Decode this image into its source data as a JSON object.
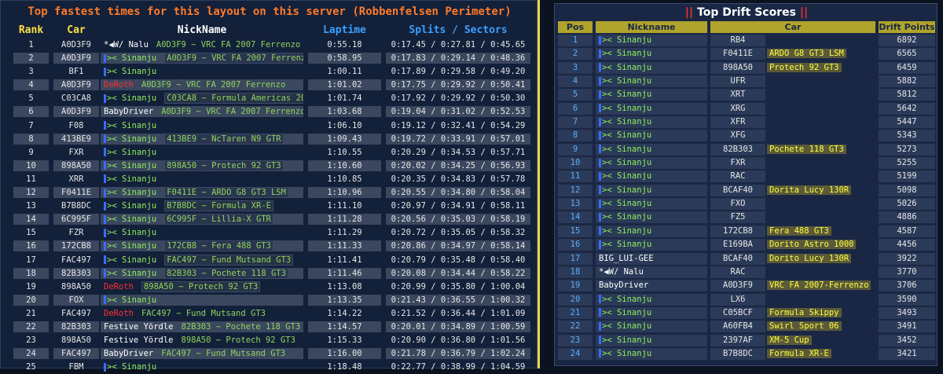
{
  "left": {
    "title": "Top fastest times for this layout on this server (Robbenfelsen Perimeter)",
    "headers": {
      "rank": "Rank",
      "car": "Car",
      "nick": "NickName",
      "laptime": "Laptime",
      "splits": "Splits / Sectors"
    },
    "rows": [
      {
        "rank": "1",
        "car": "A0D3F9",
        "nick": "*◀W/ Nalu",
        "carname": "A0D3F9 ~ VRC FA 2007 Ferrenzo",
        "lap": "0:55.18",
        "splits": "0:17.45 / 0:27.81 / 0:45.65",
        "type": "nalu",
        "box": false
      },
      {
        "rank": "2",
        "car": "A0D3F9",
        "nick": ">< Sinanju",
        "carname": "A0D3F9 ~ VRC FA 2007 Ferrenzo",
        "lap": "0:58.95",
        "splits": "0:17.83 / 0:29.14 / 0:48.36",
        "type": "sin",
        "box": true
      },
      {
        "rank": "3",
        "car": "BF1",
        "nick": ">< Sinanju",
        "carname": "",
        "lap": "1:00.11",
        "splits": "0:17.89 / 0:29.58 / 0:49.20",
        "type": "sin",
        "box": false
      },
      {
        "rank": "4",
        "car": "A0D3F9",
        "nick": "DeRoth",
        "carname": "A0D3F9 ~ VRC FA 2007 Ferrenzo",
        "lap": "1:01.02",
        "splits": "0:17.75 / 0:29.92 / 0:50.41",
        "type": "deroth",
        "box": false
      },
      {
        "rank": "5",
        "car": "C03CA8",
        "nick": ">< Sinanju",
        "carname": "C03CA8 ~ Formula Americas 2019",
        "lap": "1:01.74",
        "splits": "0:17.92 / 0:29.92 / 0:50.30",
        "type": "sin",
        "box": true
      },
      {
        "rank": "6",
        "car": "A0D3F9",
        "nick": "BabyDriver",
        "carname": "A0D3F9 ~ VRC FA 2007 Ferrenzo",
        "lap": "1:03.68",
        "splits": "0:19.04 / 0:31.02 / 0:52.53",
        "type": "baby",
        "box": false
      },
      {
        "rank": "7",
        "car": "F08",
        "nick": ">< Sinanju",
        "carname": "",
        "lap": "1:06.10",
        "splits": "0:19.12 / 0:32.41 / 0:54.29",
        "type": "sin",
        "box": false
      },
      {
        "rank": "8",
        "car": "413BE9",
        "nick": ">< Sinanju",
        "carname": "413BE9 ~ NcTaren N9 GTR",
        "lap": "1:09.43",
        "splits": "0:19.72 / 0:33.91 / 0:57.01",
        "type": "sin",
        "box": true
      },
      {
        "rank": "9",
        "car": "FXR",
        "nick": ">< Sinanju",
        "carname": "",
        "lap": "1:10.55",
        "splits": "0:20.29 / 0:34.53 / 0:57.71",
        "type": "sin",
        "box": false
      },
      {
        "rank": "10",
        "car": "898A50",
        "nick": ">< Sinanju",
        "carname": "898A50 ~ Protech 92 GT3",
        "lap": "1:10.60",
        "splits": "0:20.02 / 0:34.25 / 0:56.93",
        "type": "sin",
        "box": true
      },
      {
        "rank": "11",
        "car": "XRR",
        "nick": ">< Sinanju",
        "carname": "",
        "lap": "1:10.85",
        "splits": "0:20.35 / 0:34.83 / 0:57.78",
        "type": "sin",
        "box": false
      },
      {
        "rank": "12",
        "car": "F0411E",
        "nick": ">< Sinanju",
        "carname": "F0411E ~ ARDO G8 GT3 LSM",
        "lap": "1:10.96",
        "splits": "0:20.55 / 0:34.80 / 0:58.04",
        "type": "sin",
        "box": true
      },
      {
        "rank": "13",
        "car": "B7B8DC",
        "nick": ">< Sinanju",
        "carname": "B7B8DC ~ Formula XR-E",
        "lap": "1:11.10",
        "splits": "0:20.97 / 0:34.91 / 0:58.11",
        "type": "sin",
        "box": true
      },
      {
        "rank": "14",
        "car": "6C995F",
        "nick": ">< Sinanju",
        "carname": "6C995F ~ Lillia-X GTR",
        "lap": "1:11.28",
        "splits": "0:20.56 / 0:35.03 / 0:58.19",
        "type": "sin",
        "box": true
      },
      {
        "rank": "15",
        "car": "FZR",
        "nick": ">< Sinanju",
        "carname": "",
        "lap": "1:11.29",
        "splits": "0:20.72 / 0:35.05 / 0:58.32",
        "type": "sin",
        "box": false
      },
      {
        "rank": "16",
        "car": "172CB8",
        "nick": ">< Sinanju",
        "carname": "172CB8 ~ Fera 488 GT3",
        "lap": "1:11.33",
        "splits": "0:20.86 / 0:34.97 / 0:58.14",
        "type": "sin",
        "box": true
      },
      {
        "rank": "17",
        "car": "FAC497",
        "nick": ">< Sinanju",
        "carname": "FAC497 ~ Fund Mutsand GT3",
        "lap": "1:11.41",
        "splits": "0:20.79 / 0:35.48 / 0:58.40",
        "type": "sin",
        "box": true
      },
      {
        "rank": "18",
        "car": "82B303",
        "nick": ">< Sinanju",
        "carname": "82B303 ~ Pochete 118 GT3",
        "lap": "1:11.46",
        "splits": "0:20.08 / 0:34.44 / 0:58.22",
        "type": "sin",
        "box": true
      },
      {
        "rank": "19",
        "car": "898A50",
        "nick": "DeRoth",
        "carname": "898A50 ~ Protech 92 GT3",
        "lap": "1:13.08",
        "splits": "0:20.99 / 0:35.80 / 1:00.04",
        "type": "deroth",
        "box": true
      },
      {
        "rank": "20",
        "car": "FOX",
        "nick": ">< Sinanju",
        "carname": "",
        "lap": "1:13.35",
        "splits": "0:21.43 / 0:36.55 / 1:00.32",
        "type": "sin",
        "box": false
      },
      {
        "rank": "21",
        "car": "FAC497",
        "nick": "DeRoth",
        "carname": "FAC497 ~ Fund Mutsand GT3",
        "lap": "1:14.22",
        "splits": "0:21.52 / 0:36.44 / 1:01.09",
        "type": "deroth",
        "box": false
      },
      {
        "rank": "22",
        "car": "82B303",
        "nick": "Festive Yördle",
        "carname": "82B303 ~ Pochete 118 GT3",
        "lap": "1:14.57",
        "splits": "0:20.01 / 0:34.89 / 1:00.59",
        "type": "festive",
        "box": false
      },
      {
        "rank": "23",
        "car": "898A50",
        "nick": "Festive Yördle",
        "carname": "898A50 ~ Protech 92 GT3",
        "lap": "1:15.33",
        "splits": "0:20.90 / 0:36.80 / 1:01.56",
        "type": "festive",
        "box": false
      },
      {
        "rank": "24",
        "car": "FAC497",
        "nick": "BabyDriver",
        "carname": "FAC497 ~ Fund Mutsand GT3",
        "lap": "1:16.00",
        "splits": "0:21.78 / 0:36.79 / 1:02.24",
        "type": "baby",
        "box": false
      },
      {
        "rank": "25",
        "car": "FBM",
        "nick": ">< Sinanju",
        "carname": "",
        "lap": "1:18.48",
        "splits": "0:22.77 / 0:38.99 / 1:04.59",
        "type": "sin",
        "box": false
      }
    ]
  },
  "right": {
    "title": "Top Drift Scores",
    "headers": {
      "pos": "Pos",
      "nick": "Nickname",
      "car": "Car",
      "pts": "Drift Points"
    },
    "rows": [
      {
        "pos": "1",
        "nick": ">< Sinanju",
        "code": "RB4",
        "car": "",
        "pts": "6892",
        "type": "sin"
      },
      {
        "pos": "2",
        "nick": ">< Sinanju",
        "code": "F0411E",
        "car": "ARDO G8 GT3 LSM",
        "pts": "6565",
        "type": "sin"
      },
      {
        "pos": "3",
        "nick": ">< Sinanju",
        "code": "898A50",
        "car": "Protech 92 GT3",
        "pts": "6459",
        "type": "sin"
      },
      {
        "pos": "4",
        "nick": ">< Sinanju",
        "code": "UFR",
        "car": "",
        "pts": "5882",
        "type": "sin"
      },
      {
        "pos": "5",
        "nick": ">< Sinanju",
        "code": "XRT",
        "car": "",
        "pts": "5812",
        "type": "sin"
      },
      {
        "pos": "6",
        "nick": ">< Sinanju",
        "code": "XRG",
        "car": "",
        "pts": "5642",
        "type": "sin"
      },
      {
        "pos": "7",
        "nick": ">< Sinanju",
        "code": "XFR",
        "car": "",
        "pts": "5447",
        "type": "sin"
      },
      {
        "pos": "8",
        "nick": ">< Sinanju",
        "code": "XFG",
        "car": "",
        "pts": "5343",
        "type": "sin"
      },
      {
        "pos": "9",
        "nick": ">< Sinanju",
        "code": "82B303",
        "car": "Pochete 118 GT3",
        "pts": "5273",
        "type": "sin"
      },
      {
        "pos": "10",
        "nick": ">< Sinanju",
        "code": "FXR",
        "car": "",
        "pts": "5255",
        "type": "sin"
      },
      {
        "pos": "11",
        "nick": ">< Sinanju",
        "code": "RAC",
        "car": "",
        "pts": "5199",
        "type": "sin"
      },
      {
        "pos": "12",
        "nick": ">< Sinanju",
        "code": "BCAF40",
        "car": "Dorita Lucy 130R",
        "pts": "5098",
        "type": "sin"
      },
      {
        "pos": "13",
        "nick": ">< Sinanju",
        "code": "FXO",
        "car": "",
        "pts": "5026",
        "type": "sin"
      },
      {
        "pos": "14",
        "nick": ">< Sinanju",
        "code": "FZ5",
        "car": "",
        "pts": "4886",
        "type": "sin"
      },
      {
        "pos": "15",
        "nick": ">< Sinanju",
        "code": "172CB8",
        "car": "Fera 488 GT3",
        "pts": "4587",
        "type": "sin"
      },
      {
        "pos": "16",
        "nick": ">< Sinanju",
        "code": "E169BA",
        "car": "Dorito Astro 1000",
        "pts": "4456",
        "type": "sin"
      },
      {
        "pos": "17",
        "nick": "BIG_LUI-GEE",
        "code": "BCAF40",
        "car": "Dorito Lucy 130R",
        "pts": "3922",
        "type": "plain"
      },
      {
        "pos": "18",
        "nick": "*◀W/ Nalu",
        "code": "RAC",
        "car": "",
        "pts": "3770",
        "type": "nalu"
      },
      {
        "pos": "19",
        "nick": "BabyDriver",
        "code": "A0D3F9",
        "car": "VRC FA 2007-Ferrenzo",
        "pts": "3706",
        "type": "baby"
      },
      {
        "pos": "20",
        "nick": ">< Sinanju",
        "code": "LX6",
        "car": "",
        "pts": "3590",
        "type": "sin"
      },
      {
        "pos": "21",
        "nick": ">< Sinanju",
        "code": "C05BCF",
        "car": "Formula Skippy",
        "pts": "3493",
        "type": "sin"
      },
      {
        "pos": "22",
        "nick": ">< Sinanju",
        "code": "A60FB4",
        "car": "Swirl Sport 06",
        "pts": "3491",
        "type": "sin"
      },
      {
        "pos": "23",
        "nick": ">< Sinanju",
        "code": "2397AF",
        "car": "XM-5 Cup",
        "pts": "3452",
        "type": "sin"
      },
      {
        "pos": "24",
        "nick": ">< Sinanju",
        "code": "B7B8DC",
        "car": "Formula XR-E",
        "pts": "3421",
        "type": "sin"
      }
    ]
  },
  "colors": {
    "left_title": "#ff7a2a",
    "header_yellow": "#ffe040",
    "header_blue": "#3aa0ff",
    "sinanju": "#8ff05c",
    "pos_blue": "#5ab0ff",
    "car_yellow": "#ffff40"
  }
}
